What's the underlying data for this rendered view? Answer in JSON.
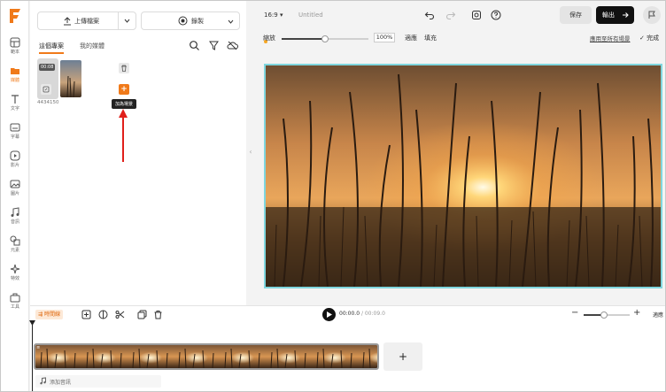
{
  "sidebar": {
    "items": [
      {
        "icon": "template-icon",
        "label": "範本",
        "active": false
      },
      {
        "icon": "folder-icon",
        "label": "媒體",
        "active": true
      },
      {
        "icon": "text-icon",
        "label": "文字",
        "active": false
      },
      {
        "icon": "subtitle-icon",
        "label": "字幕",
        "active": false
      },
      {
        "icon": "video-icon",
        "label": "影片",
        "active": false
      },
      {
        "icon": "image-icon",
        "label": "圖片",
        "active": false
      },
      {
        "icon": "music-icon",
        "label": "音訊",
        "active": false
      },
      {
        "icon": "shapes-icon",
        "label": "元素",
        "active": false
      },
      {
        "icon": "sparkle-icon",
        "label": "特效",
        "active": false
      },
      {
        "icon": "toolbox-icon",
        "label": "工具",
        "active": false
      }
    ]
  },
  "panel": {
    "upload_label": "上傳檔案",
    "record_label": "錄製",
    "tab_project": "這個專案",
    "tab_mine": "我的媒體",
    "media": {
      "duration": "00:08",
      "filename": "4434150",
      "tooltip": "加為場景"
    }
  },
  "topbar": {
    "ratio": "16:9",
    "title": "Untitled",
    "save_label": "保存",
    "export_label": "輸出"
  },
  "zoom": {
    "label": "縮放",
    "percent": "100%",
    "level": 0.5,
    "fit_label": "適應",
    "fill_label": "填充",
    "apply_all": "應用至所有場景",
    "done_label": "完成"
  },
  "timeline": {
    "badge": "時間線",
    "current_time": "00:00.0",
    "total_time": "/ 00:09.0",
    "fit_label": "適應",
    "add_audio": "添加音訊",
    "zoom_level": 0.45
  },
  "colors": {
    "accent": "#f07a1a",
    "canvas_border": "#7fd6de",
    "export_bg": "#111111"
  }
}
